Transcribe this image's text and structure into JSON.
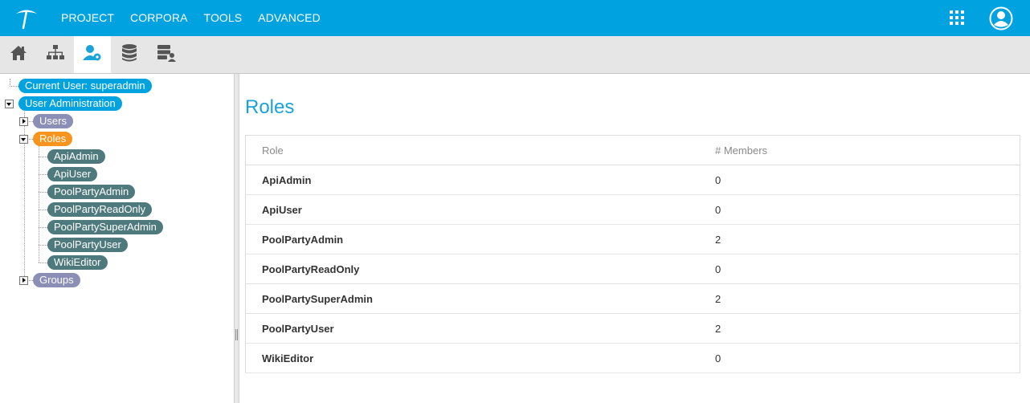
{
  "topbar": {
    "brand_color": "#00a3e0",
    "menu": [
      "PROJECT",
      "CORPORA",
      "TOOLS",
      "ADVANCED"
    ],
    "icons": {
      "logo": "pickaxe-logo-icon",
      "apps": "apps-grid-icon",
      "user": "user-account-icon"
    }
  },
  "toolbar": {
    "icons": [
      "home-icon",
      "hierarchy-icon",
      "user-admin-icon",
      "database-icon",
      "server-user-icon"
    ],
    "active_index": 2
  },
  "tree": {
    "current_user": "Current User: superadmin",
    "user_admin": "User Administration",
    "users": "Users",
    "roles": "Roles",
    "role_items": [
      "ApiAdmin",
      "ApiUser",
      "PoolPartyAdmin",
      "PoolPartyReadOnly",
      "PoolPartySuperAdmin",
      "PoolPartyUser",
      "WikiEditor"
    ],
    "groups": "Groups"
  },
  "main": {
    "title": "Roles",
    "columns": [
      "Role",
      "# Members"
    ],
    "rows": [
      {
        "role": "ApiAdmin",
        "members": "0"
      },
      {
        "role": "ApiUser",
        "members": "0"
      },
      {
        "role": "PoolPartyAdmin",
        "members": "2"
      },
      {
        "role": "PoolPartyReadOnly",
        "members": "0"
      },
      {
        "role": "PoolPartySuperAdmin",
        "members": "2"
      },
      {
        "role": "PoolPartyUser",
        "members": "2"
      },
      {
        "role": "WikiEditor",
        "members": "0"
      }
    ]
  }
}
